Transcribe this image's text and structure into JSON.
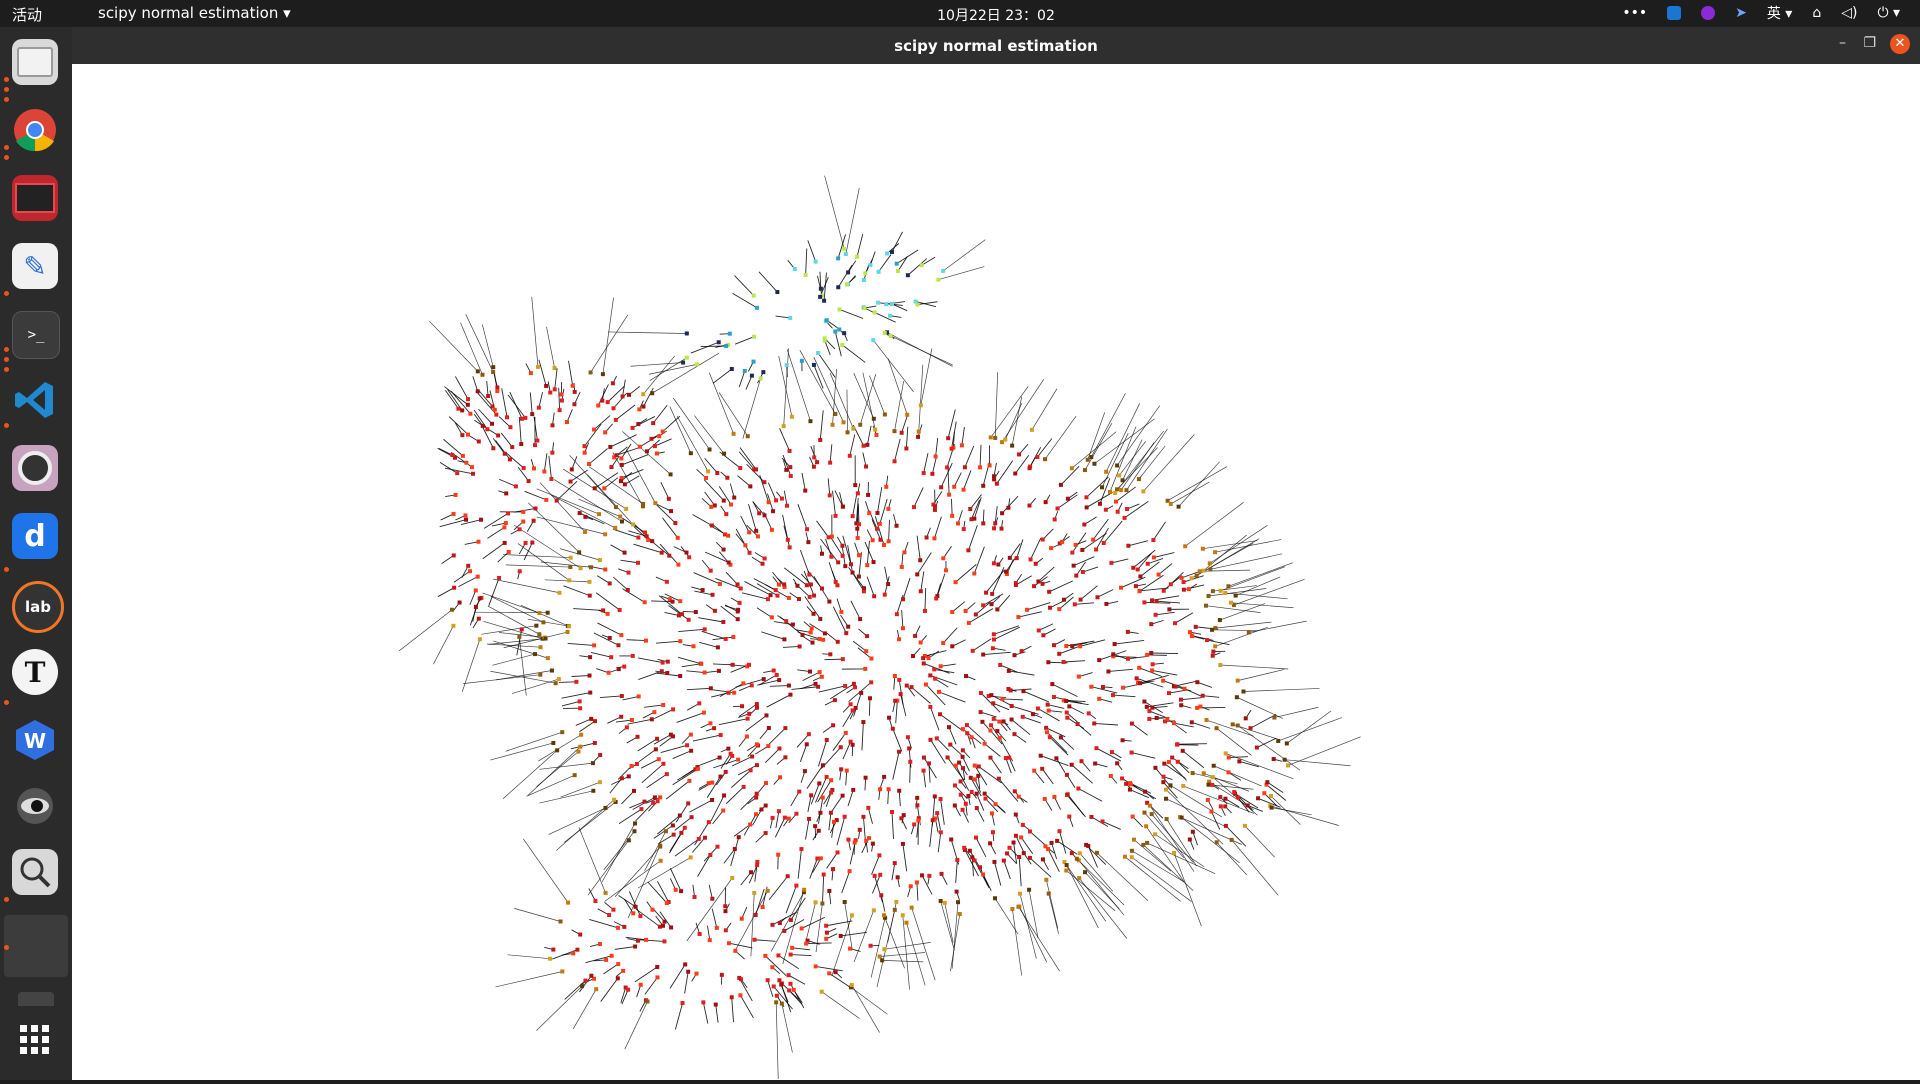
{
  "topbar": {
    "activities": "活动",
    "app_menu": "scipy normal estimation",
    "clock": "10月22日  23：02",
    "input_method": "英"
  },
  "window": {
    "title": "scipy normal estimation"
  },
  "dock": {
    "apps": [
      "files",
      "chrome",
      "terminal-red",
      "text-editor",
      "terminal",
      "vscode",
      "camera",
      "dict",
      "jupyterlab",
      "typora",
      "wps",
      "eye",
      "search",
      "blank",
      "show-apps"
    ]
  },
  "plot": {
    "description_hidden": ""
  }
}
